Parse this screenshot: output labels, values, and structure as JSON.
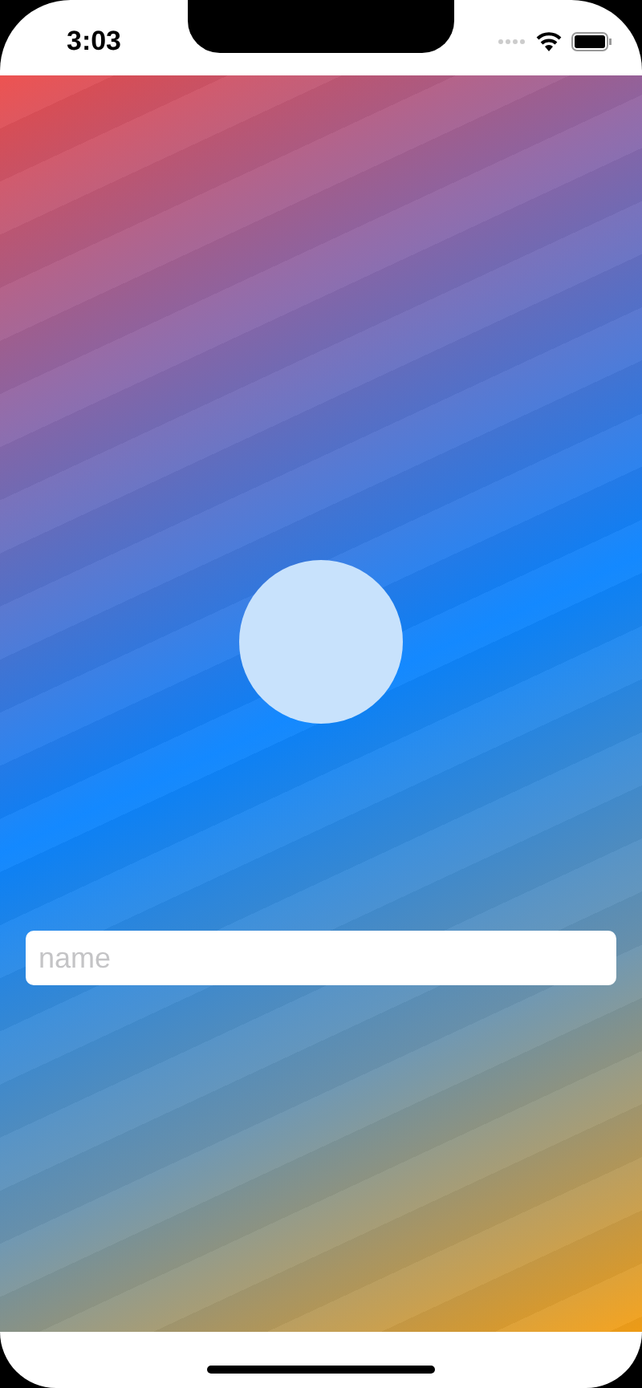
{
  "status_bar": {
    "time": "3:03"
  },
  "name_field": {
    "placeholder": "name"
  }
}
